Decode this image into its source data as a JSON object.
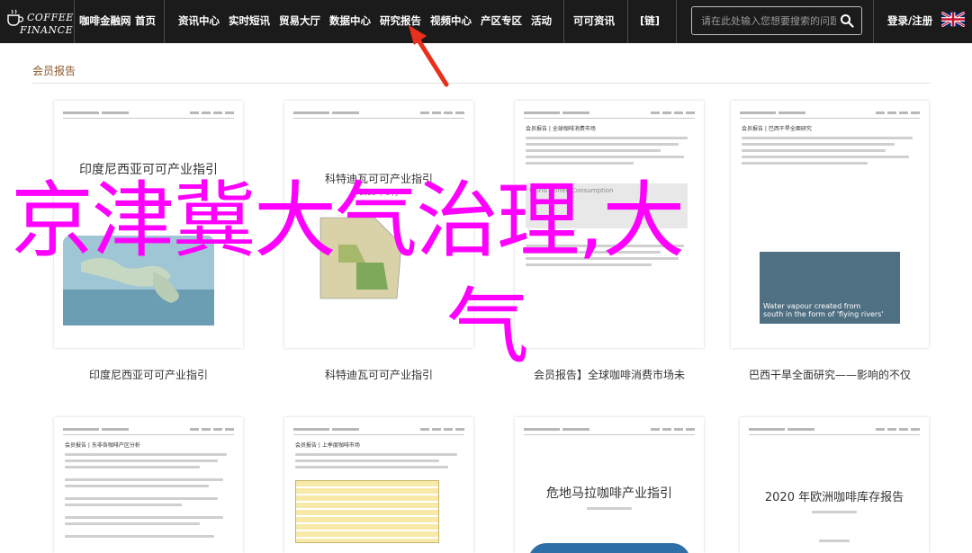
{
  "logo": {
    "line1": "COFFEE",
    "line2": "FINANCE"
  },
  "nav": {
    "items": [
      "咖啡金融网",
      "首页",
      "资讯中心",
      "实时短讯",
      "贸易大厅",
      "数据中心",
      "研究报告",
      "视频中心",
      "产区专区",
      "活动",
      "可可资讯",
      "[链]"
    ],
    "login": "登录/注册"
  },
  "search": {
    "placeholder": "请在此处输入您想要搜索的问题"
  },
  "section": {
    "title": "会员报告"
  },
  "reports": [
    {
      "doc_title": "印度尼西亚可可产业指引",
      "caption": "印度尼西亚可可产业指引"
    },
    {
      "doc_title": "科特迪瓦可可产业指引",
      "doc_date": "2021 年 5 月",
      "caption": "科特迪瓦可可产业指引"
    },
    {
      "doc_heading": "会员报告 | 全球咖啡消费市场",
      "chart_label": "World Coffee Consumption",
      "caption": "会员报告】全球咖啡消费市场未"
    },
    {
      "doc_heading": "会员报告 | 巴西干旱全面研究",
      "photo_text": "Water vapour created from\nsouth in the form of 'flying rivers'",
      "caption": "巴西干旱全面研究——影响的不仅"
    },
    {
      "doc_heading": "会员报告 | 东非各咖啡产区分析"
    },
    {
      "doc_heading": "会员报告 | 上季度咖啡市场"
    },
    {
      "doc_title": "危地马拉咖啡产业指引"
    },
    {
      "doc_title": "2020 年欧洲咖啡库存报告"
    }
  ],
  "watermark": {
    "line1": "京津冀大气治理,大",
    "line2": "气"
  },
  "colors": {
    "nav_bg": "#1b1b1b",
    "watermark": "#ff00ff",
    "section_title": "#8a5a2a",
    "arrow": "#e8301c"
  }
}
